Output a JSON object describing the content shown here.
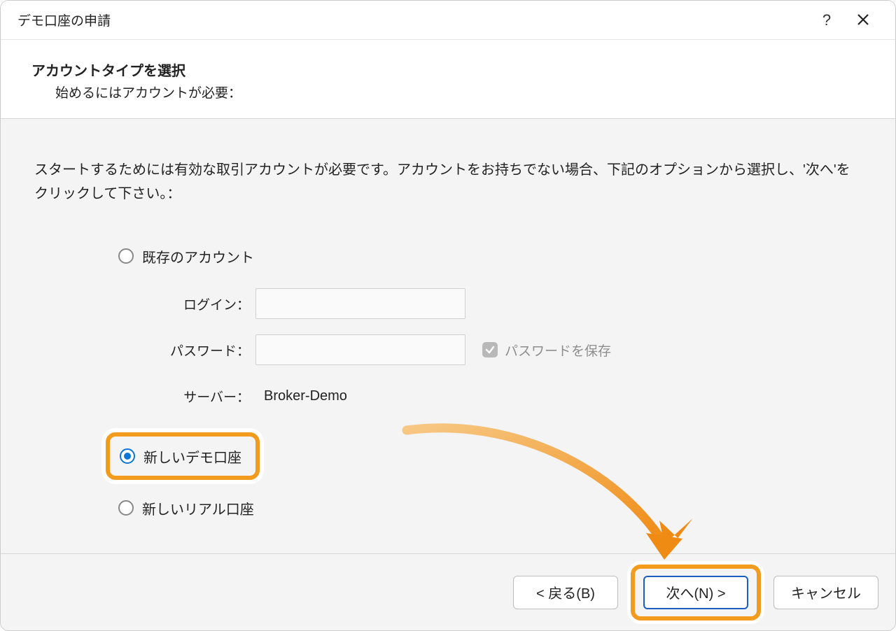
{
  "titlebar": {
    "title": "デモ口座の申請"
  },
  "header": {
    "heading": "アカウントタイプを選択",
    "subheading": "始めるにはアカウントが必要："
  },
  "content": {
    "instructions": "スタートするためには有効な取引アカウントが必要です。アカウントをお持ちでない場合、下記のオプションから選択し、'次へ'をクリックして下さい。：",
    "options": {
      "existing": {
        "label": "既存のアカウント"
      },
      "new_demo": {
        "label": "新しいデモ口座"
      },
      "new_real": {
        "label": "新しいリアル口座"
      }
    },
    "fields": {
      "login": {
        "label": "ログイン：",
        "value": ""
      },
      "password": {
        "label": "パスワード：",
        "value": "",
        "save_label": "パスワードを保存"
      },
      "server": {
        "label": "サーバー：",
        "value": "Broker-Demo"
      }
    }
  },
  "footer": {
    "back": "< 戻る(B)",
    "next": "次へ(N) >",
    "cancel": "キャンセル"
  }
}
